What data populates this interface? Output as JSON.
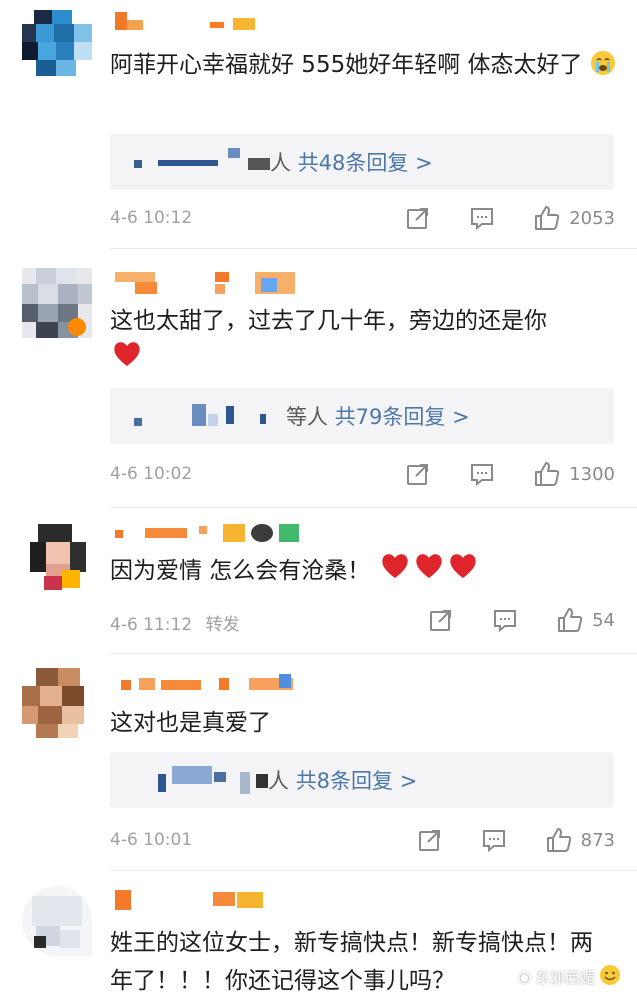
{
  "comments": [
    {
      "text": "阿菲开心幸福就好 555她好年轻啊 体态太好了",
      "reply_prefix": "人",
      "reply_link": "共48条回复 >",
      "time": "4-6 10:12",
      "likes": "2053"
    },
    {
      "text": "这也太甜了，过去了几十年，旁边的还是你",
      "reply_prefix": "等人",
      "reply_link": "共79条回复 >",
      "time": "4-6 10:02",
      "likes": "1300"
    },
    {
      "text": "因为爱情 怎么会有沧桑！",
      "time": "4-6 11:12",
      "forward": "转发",
      "likes": "54"
    },
    {
      "text": "这对也是真爱了",
      "reply_prefix": "人",
      "reply_link": "共8条回复 >",
      "time": "4-6 10:01",
      "likes": "873"
    },
    {
      "text": "姓王的这位女士，新专搞快点！新专搞快点！两年了！！！你还记得这个事儿吗？"
    }
  ],
  "watermark": "东邪西媚",
  "icons": {
    "share": "share-icon",
    "comment": "comment-icon",
    "like": "thumbs-up-icon",
    "heart": "heart-icon",
    "crying": "crying-face-icon",
    "smile": "smile-icon"
  },
  "colors": {
    "link": "#4b77a9",
    "heart": "#e0242b",
    "meta": "#a0a0a0",
    "reply_bg": "#f4f4f6"
  }
}
